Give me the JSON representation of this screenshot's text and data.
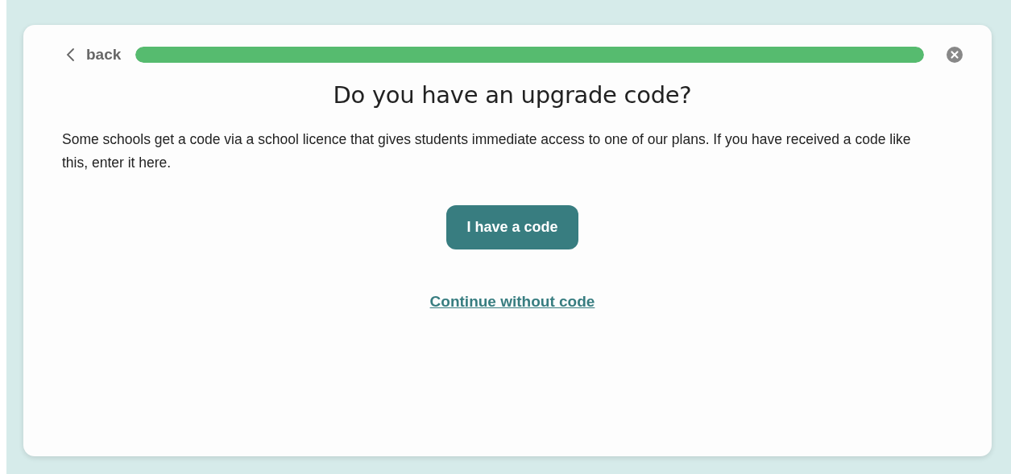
{
  "header": {
    "back_label": "back",
    "progress": {
      "level": 1
    }
  },
  "title": "Do you have an upgrade code?",
  "description": "Some schools get a code via a school licence that gives students immediate access to one of our plans. If you have received a code like this, enter it here.",
  "primary_button": "I have a code",
  "secondary_link": "Continue without code"
}
